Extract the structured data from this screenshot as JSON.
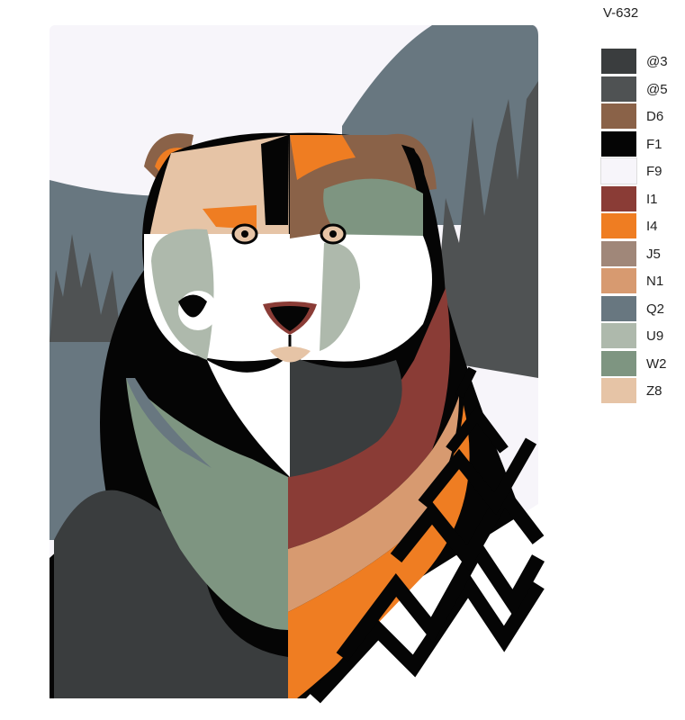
{
  "sheet": {
    "code": "V-632"
  },
  "palette": [
    {
      "code": "@3",
      "color": "#3a3d3e"
    },
    {
      "code": "@5",
      "color": "#4f5253"
    },
    {
      "code": "D6",
      "color": "#8a6248"
    },
    {
      "code": "F1",
      "color": "#050505"
    },
    {
      "code": "F9",
      "color": "#f7f5fa"
    },
    {
      "code": "I1",
      "color": "#8a3c36"
    },
    {
      "code": "I4",
      "color": "#ef7d22"
    },
    {
      "code": "J5",
      "color": "#a08779"
    },
    {
      "code": "N1",
      "color": "#d79a70"
    },
    {
      "code": "Q2",
      "color": "#687780"
    },
    {
      "code": "U9",
      "color": "#aeb9ac"
    },
    {
      "code": "W2",
      "color": "#7e9581"
    },
    {
      "code": "Z8",
      "color": "#e6c4a6"
    }
  ]
}
